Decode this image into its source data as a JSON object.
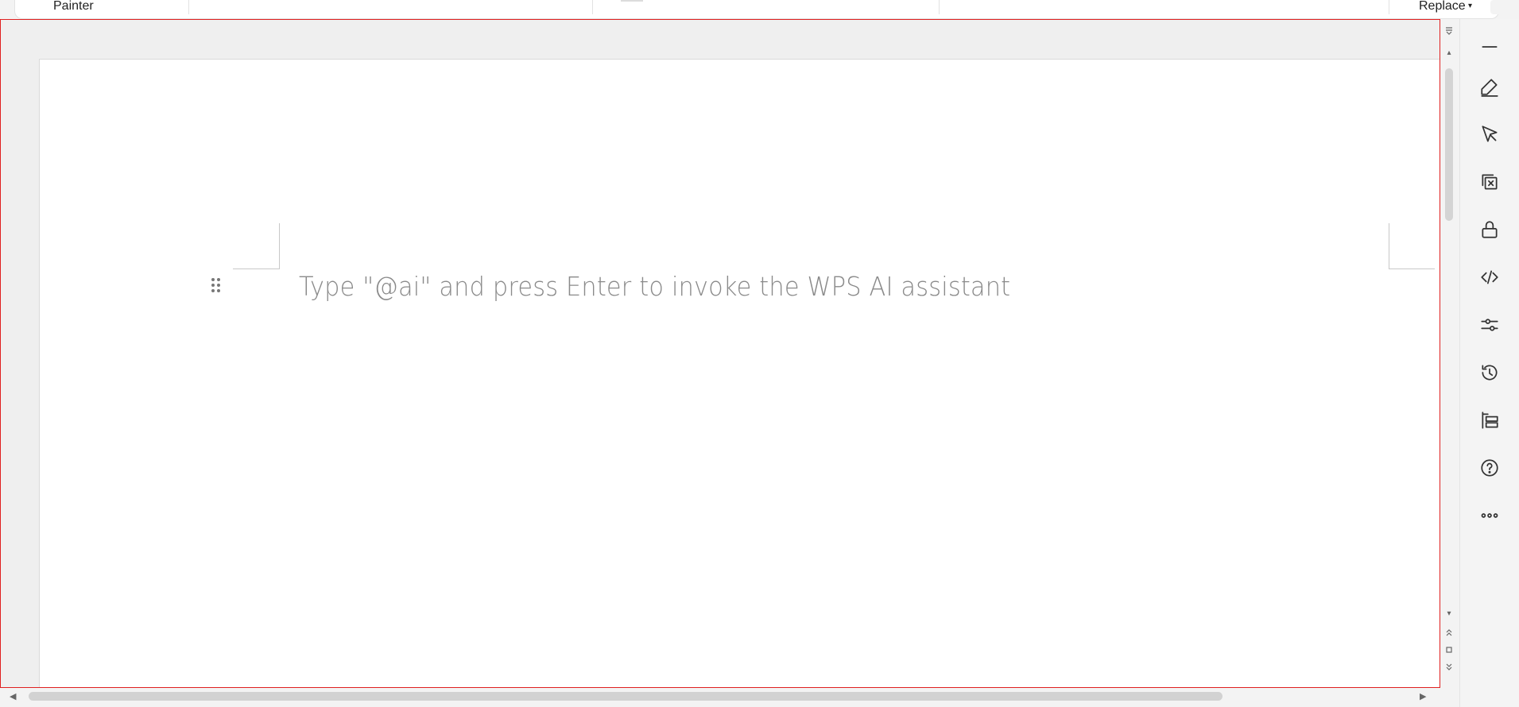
{
  "toolbar": {
    "painter_label": "Painter",
    "replace_label": "Replace",
    "replace_dropdown_icon": "chevron-down-icon"
  },
  "document": {
    "placeholder": "Type \"@ai\" and press Enter to invoke the WPS AI assistant",
    "drag_handle_icon": "drag-handle-icon"
  },
  "scrollbars": {
    "vertical_icons": [
      "scroll-options-icon",
      "scroll-up-icon",
      "scroll-down-icon",
      "previous-page-icon",
      "select-browse-object-icon",
      "next-page-icon"
    ],
    "horizontal_icons": [
      "scroll-left-icon",
      "scroll-right-icon"
    ]
  },
  "side_panel": {
    "items": [
      {
        "icon": "minimize-icon"
      },
      {
        "icon": "pen-icon"
      },
      {
        "icon": "select-pointer-icon"
      },
      {
        "icon": "clear-format-icon"
      },
      {
        "icon": "lock-icon"
      },
      {
        "icon": "code-icon"
      },
      {
        "icon": "adjust-settings-icon"
      },
      {
        "icon": "history-icon"
      },
      {
        "icon": "outline-tree-icon"
      },
      {
        "icon": "help-icon"
      },
      {
        "icon": "more-icon"
      }
    ]
  },
  "colors": {
    "selection_border": "#e02020",
    "placeholder_text": "#8a8a8a",
    "page_background": "#ffffff",
    "canvas_background": "#efefef"
  }
}
